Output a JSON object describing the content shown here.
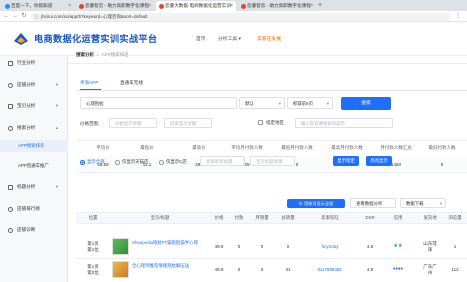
{
  "browser": {
    "tabs": [
      {
        "label": "百度一下，你就知道",
        "fav": "#3385ff"
      },
      {
        "label": "您睿智云 - 助力高职数字化课程",
        "fav": "#d9473c"
      },
      {
        "label": "您睿大数据-电商数据化运营实训",
        "fav": "#d9473c"
      },
      {
        "label": "您睿智云 - 助力高职数字化课程",
        "fav": "#d9473c"
      }
    ],
    "url": "jhsirui.com/so/app/5?keyword=心理咨询&sort=default"
  },
  "header": {
    "title": "电商数据化运营实训实战平台",
    "nav": [
      "首页",
      "分析工具 ▾",
      "卖家在发展"
    ]
  },
  "sidebar": {
    "items": [
      {
        "label": "行业分析",
        "chev": ""
      },
      {
        "label": "店铺分析",
        "chev": "▾"
      },
      {
        "label": "宝贝分析",
        "chev": "▾"
      },
      {
        "label": "搜索分析",
        "chev": "▴"
      }
    ],
    "subitems": [
      "APP搜索排名",
      "APP直通车推广"
    ],
    "more_items": [
      {
        "label": "标题分析",
        "chev": "▾"
      },
      {
        "label": "店铺排行榜",
        "chev": ""
      },
      {
        "label": "店铺诊断",
        "chev": ""
      }
    ]
  },
  "breadcrumb": {
    "root": "搜索分析",
    "sep": "/",
    "current": "APP搜索排名"
  },
  "tabs": [
    "手淘APP",
    "直通车无线"
  ],
  "search": {
    "keyword": "心理抱枕",
    "sort_select": "默认",
    "pages_select": "抓取前5页",
    "button": "搜索"
  },
  "price_filter": {
    "label": "价格范围:",
    "min_placeholder": "开始显示金额",
    "max_placeholder": "结束显示金额",
    "region_label": "指定地区",
    "region_placeholder": "输入您说要搜索的城市"
  },
  "stats": {
    "headers": [
      "平均价",
      "最低价",
      "最高价",
      "平均月付款人数",
      "最低月付款人数",
      "最高月付款人数",
      "月付款人数汇总",
      "最低付款人数"
    ],
    "values": [
      "59.59",
      "11.1",
      "299",
      "29",
      "0",
      "375",
      "1460",
      "0"
    ]
  },
  "display_options": {
    "radios": [
      "显示全部",
      "仅显示天猫店",
      "仅显示C店"
    ],
    "selected": 0,
    "nick_placeholder": "卖家昵称关键",
    "shop_placeholder": "宝贝标题关键",
    "show_button": "显示指定",
    "highlight_button": "高亮显示",
    "export_button": "⊕ 用账号显示全部",
    "select1": "查看数据分析",
    "select2": "数据下载"
  },
  "results": {
    "headers": [
      "位置",
      "宝贝/标题",
      "价格",
      "付款",
      "月销量",
      "总销量",
      "卖家旺旺",
      "DSR",
      "信用",
      "发货地",
      "浏览量"
    ],
    "rows": [
      {
        "position": [
          "第1页",
          "第1位"
        ],
        "title": "Sheepedia抱枕FF猫抱抱猫半心理",
        "price": "49.9",
        "pay": "0",
        "monthly": "0",
        "total": "0",
        "seller": "hcynoby",
        "dsr": "4.9",
        "credit": "♛♛",
        "location": [
          "山东菏",
          "泽"
        ],
        "views": "1"
      },
      {
        "position": [
          "第1页",
          "第2位"
        ],
        "title": "全心理师推荐情绪抱枕解压送",
        "price": "49.9",
        "pay": "0",
        "monthly": "0",
        "total": "31",
        "seller": "tb17695452",
        "dsr": "4.9",
        "credit": "♦♦♦♦",
        "location": [
          "广东广",
          "州"
        ],
        "views": "112"
      }
    ]
  }
}
